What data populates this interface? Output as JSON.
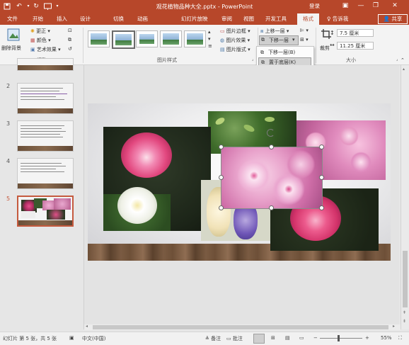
{
  "titlebar": {
    "title": "观花植物品种大全.pptx - PowerPoint",
    "login": "登录",
    "qa": {
      "save": "save-icon",
      "undo": "undo-icon",
      "redo": "redo-icon",
      "customize": "customize-icon"
    }
  },
  "tabs": [
    "文件",
    "开始",
    "插入",
    "设计",
    "切换",
    "动画",
    "幻灯片放映",
    "审阅",
    "视图",
    "开发工具",
    "格式"
  ],
  "active_tab": "格式",
  "tellme": "告诉我",
  "share": "共享",
  "ribbon": {
    "remove_bg": "删除背景",
    "correct": "更正",
    "color": "颜色",
    "artistic": "艺术效果",
    "adjust_label": "调整",
    "styles_label": "图片样式",
    "border": "图片边框",
    "effects": "图片效果",
    "layout": "图片版式",
    "bring_forward": "上移一层",
    "send_backward": "下移一层",
    "crop": "裁剪",
    "height": "7.5 厘米",
    "width": "11.25 厘米",
    "size_label": "大小"
  },
  "dropdown": {
    "items": [
      "下移一层(B)",
      "置于底层(K)"
    ],
    "highlighted": 1
  },
  "slides": {
    "numbers": [
      "2",
      "3",
      "4",
      "5"
    ],
    "selected": "5"
  },
  "status": {
    "slide_info": "幻灯片 第 5 张，共 5 张",
    "language": "中文(中国)",
    "notes": "备注",
    "comments": "批注",
    "zoom": "55%"
  },
  "colors": {
    "accent": "#b7472a",
    "selection": "#c55a3e"
  }
}
